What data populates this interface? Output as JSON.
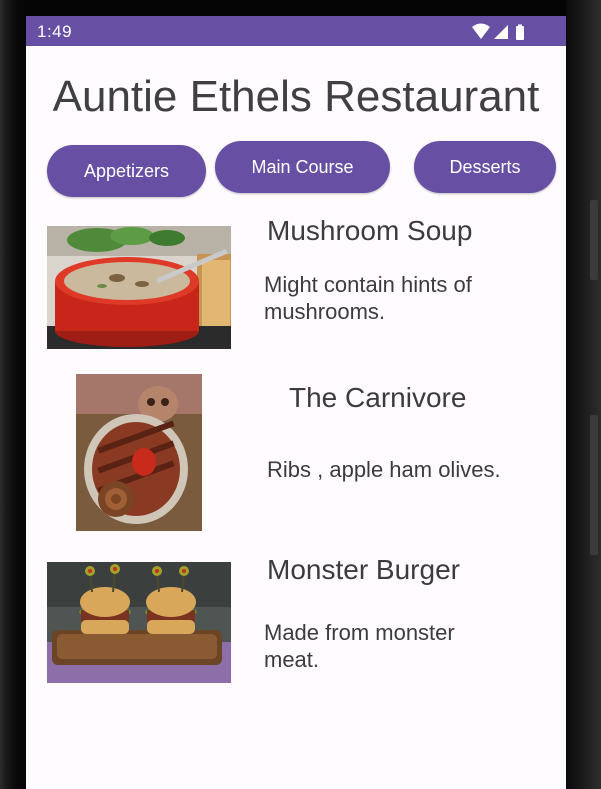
{
  "status_bar": {
    "time": "1:49",
    "icons": [
      "wifi-icon",
      "cellular-signal-icon",
      "battery-icon"
    ]
  },
  "app": {
    "title": "Auntie Ethels Restaurant"
  },
  "categories": [
    {
      "label": "Appetizers"
    },
    {
      "label": "Main Course"
    },
    {
      "label": "Desserts"
    }
  ],
  "menu_items": [
    {
      "name": "Mushroom Soup",
      "description": "Might contain hints of mushrooms."
    },
    {
      "name": "The Carnivore",
      "description": "Ribs , apple ham olives."
    },
    {
      "name": "Monster Burger",
      "description": "Made from monster meat."
    }
  ],
  "colors": {
    "primary": "#6750a4",
    "background": "#fffbfe",
    "text": "#3f3f44"
  }
}
